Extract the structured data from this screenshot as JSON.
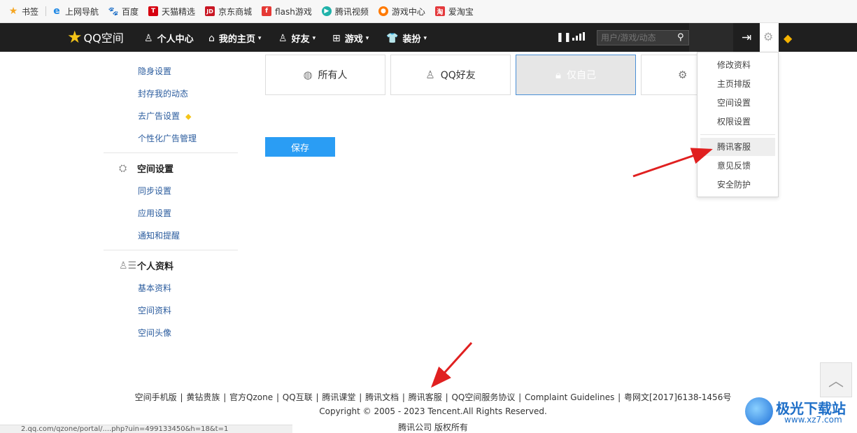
{
  "bookmarks": [
    {
      "label": "书签",
      "icon": "star-icon",
      "color": "#f5a623"
    },
    {
      "label": "上网导航",
      "icon": "ie-icon",
      "color": "#1e88e5"
    },
    {
      "label": "百度",
      "icon": "baidu-paw-icon",
      "color": "#2932e1"
    },
    {
      "label": "天猫精选",
      "icon": "tmall-icon",
      "color": "#d6000f"
    },
    {
      "label": "京东商城",
      "icon": "jd-icon",
      "color": "#c91623"
    },
    {
      "label": "flash游戏",
      "icon": "flash-icon",
      "color": "#e53935"
    },
    {
      "label": "腾讯视频",
      "icon": "tencent-video-icon",
      "color": "#20b2aa"
    },
    {
      "label": "游戏中心",
      "icon": "game-center-icon",
      "color": "#ff7a00"
    },
    {
      "label": "爱淘宝",
      "icon": "taobao-icon",
      "color": "#e4393c"
    }
  ],
  "nav": {
    "logo": "QQ空间",
    "personal_center": "个人中心",
    "my_home": "我的主页",
    "friends": "好友",
    "games": "游戏",
    "dress_up": "装扮",
    "search_placeholder": "用户/游戏/动态"
  },
  "sidebar": {
    "privacy_links": [
      "隐身设置",
      "封存我的动态",
      "去广告设置",
      "个性化广告管理"
    ],
    "space_settings": {
      "title": "空间设置",
      "links": [
        "同步设置",
        "应用设置",
        "通知和提醒"
      ]
    },
    "profile": {
      "title": "个人资料",
      "links": [
        "基本资料",
        "空间资料",
        "空间头像"
      ]
    }
  },
  "permissions": {
    "options": [
      "所有人",
      "QQ好友",
      "仅自己"
    ],
    "selected": "仅自己"
  },
  "save_label": "保存",
  "menu": {
    "group1": [
      "修改资料",
      "主页排版",
      "空间设置",
      "权限设置"
    ],
    "group2": [
      "腾讯客服",
      "意见反馈",
      "安全防护"
    ],
    "hovered": "腾讯客服"
  },
  "footer": {
    "links": [
      "空间手机版",
      "黄钻贵族",
      "官方Qzone",
      "QQ互联",
      "腾讯课堂",
      "腾讯文档",
      "腾讯客服",
      "QQ空间服务协议",
      "Complaint Guidelines",
      "粤网文[2017]6138-1456号"
    ],
    "copyright": "Copyright © 2005 - 2023 Tencent.All Rights Reserved.",
    "company": "腾讯公司 版权所有"
  },
  "status_url": "2.qq.com/qzone/portal/....php?uin=499133450&h=18&t=1",
  "watermark": {
    "title": "极光下载站",
    "url": "www.xz7.com"
  },
  "colors": {
    "nav_bg": "#1f1f1f",
    "accent_blue": "#2a9df4",
    "arrow_red": "#e02020"
  }
}
